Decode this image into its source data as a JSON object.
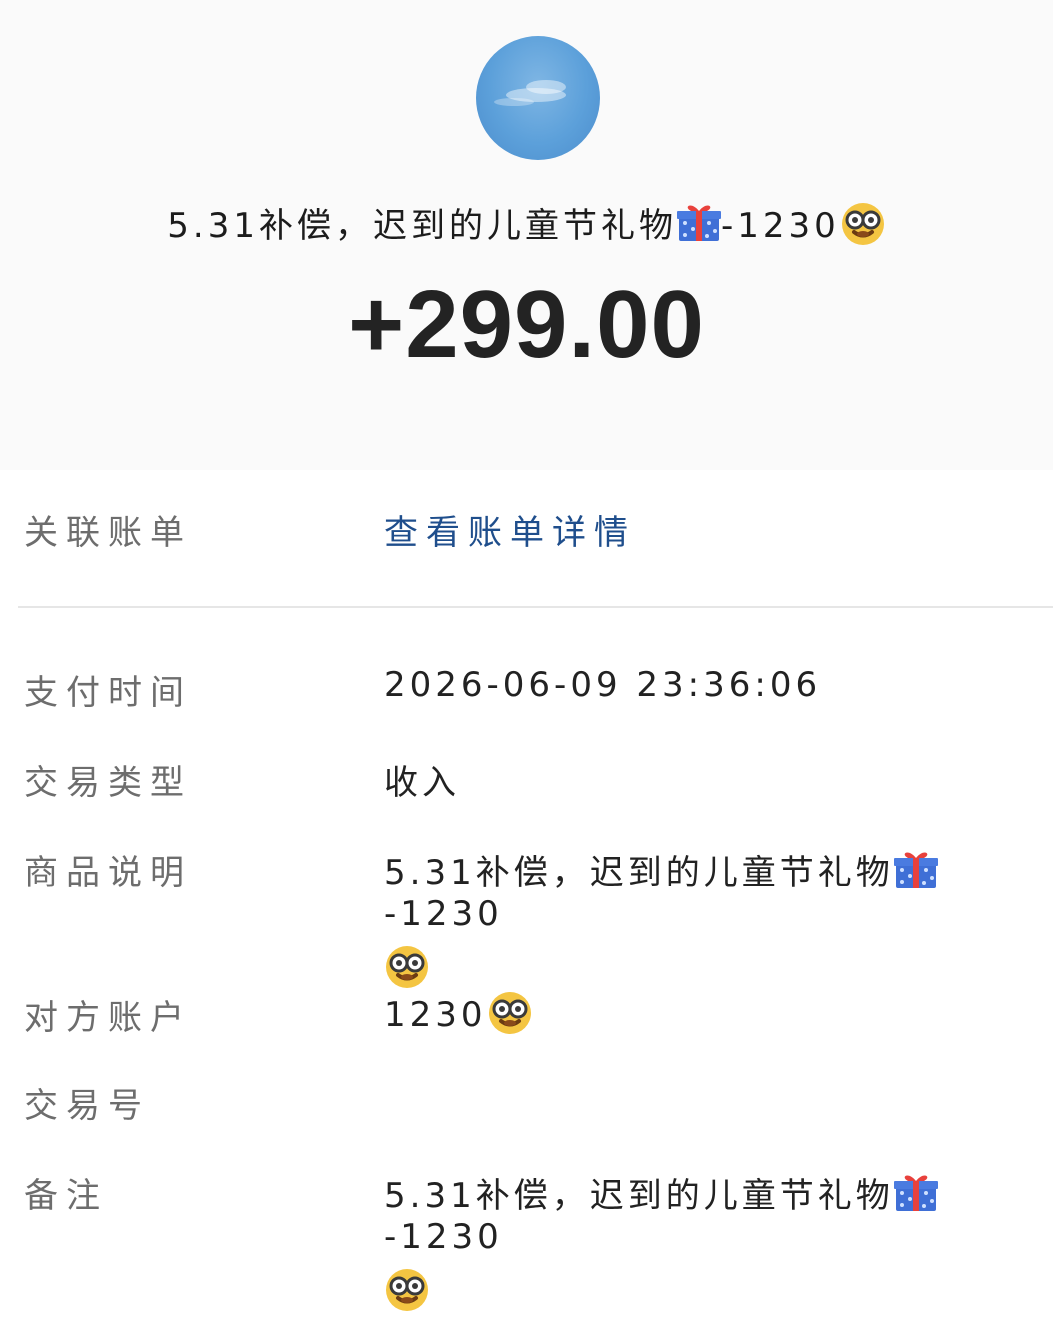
{
  "header": {
    "title_text": "5.31补偿，迟到的儿童节礼物",
    "title_suffix": "-1230",
    "amount": "+299.00"
  },
  "related_bill": {
    "label": "关联账单",
    "link": "查看账单详情"
  },
  "details": [
    {
      "label": "支付时间",
      "value": "2026-06-09  23:36:06"
    },
    {
      "label": "交易类型",
      "value": "收入"
    },
    {
      "label": "商品说明",
      "value": "5.31补偿，迟到的儿童节礼物",
      "suffix": "-1230"
    },
    {
      "label": "对方账户",
      "value": "1230"
    },
    {
      "label": "交易号",
      "value": ""
    },
    {
      "label": "备注",
      "value": "5.31补偿，迟到的儿童节礼物",
      "suffix": "-1230"
    }
  ],
  "icons": {
    "avatar": "sky-avatar",
    "gift": "gift-emoji",
    "face": "nerd-face-emoji"
  }
}
